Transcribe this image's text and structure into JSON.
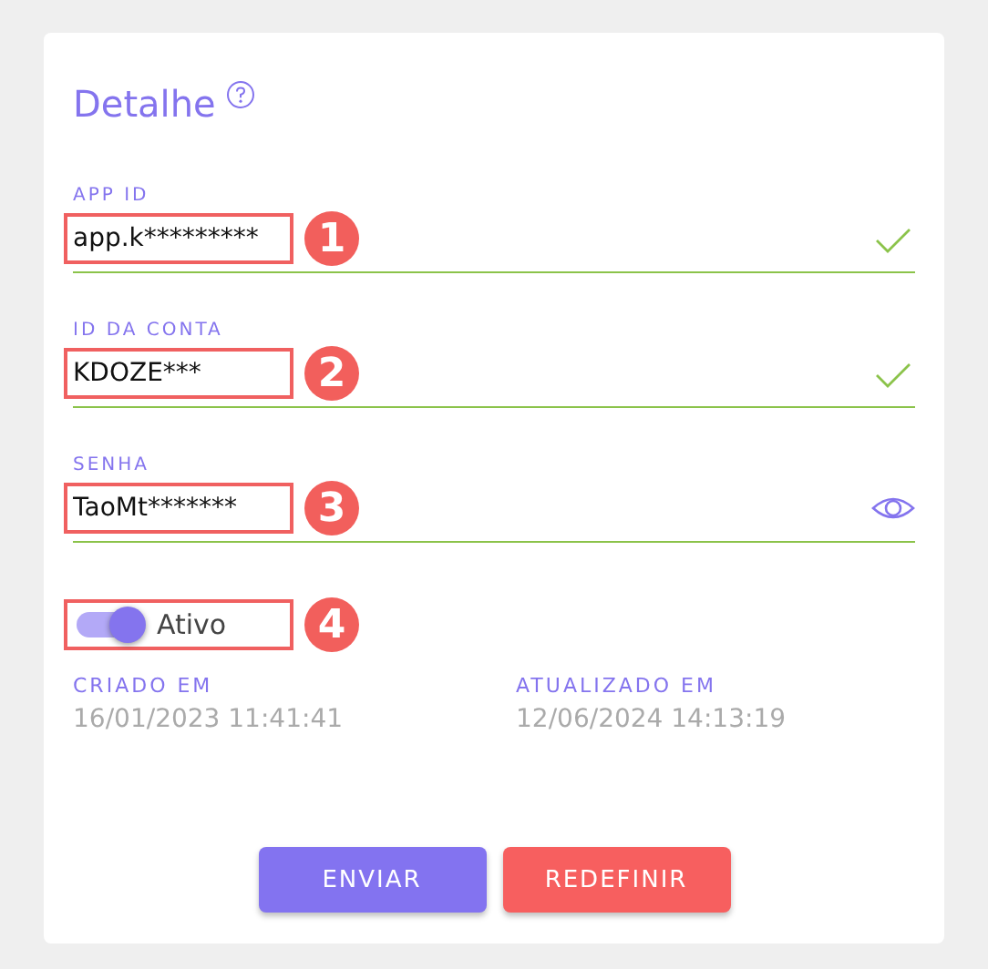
{
  "title": "Detalhe",
  "fields": [
    {
      "label": "APP ID",
      "value": "app.k*********",
      "valid": true,
      "kind": "check",
      "callout": "1"
    },
    {
      "label": "ID DA CONTA",
      "value": "KDOZE***",
      "valid": true,
      "kind": "check",
      "callout": "2"
    },
    {
      "label": "SENHA",
      "value": "TaoMt*******",
      "valid": true,
      "kind": "password",
      "callout": "3"
    }
  ],
  "toggle": {
    "label": "Ativo",
    "on": true,
    "callout": "4"
  },
  "dates": [
    {
      "label": "CRIADO EM",
      "value": "16/01/2023 11:41:41"
    },
    {
      "label": "ATUALIZADO EM",
      "value": "12/06/2024 14:13:19"
    }
  ],
  "buttons": [
    {
      "label": "ENVIAR",
      "kind": "primary"
    },
    {
      "label": "REDEFINIR",
      "kind": "reset"
    }
  ]
}
